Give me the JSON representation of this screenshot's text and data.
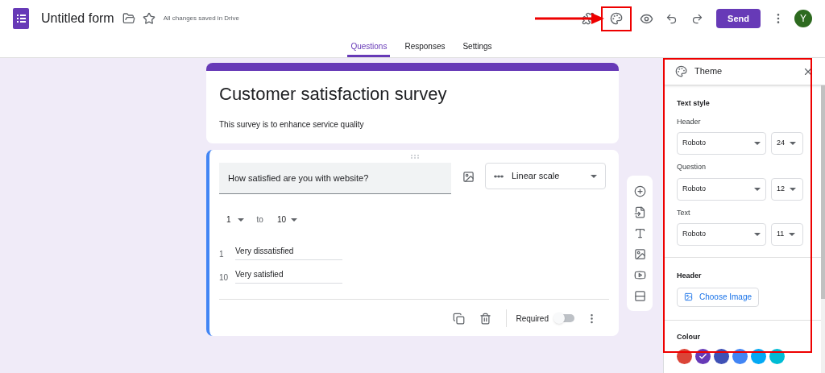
{
  "header": {
    "title": "Untitled form",
    "save_status": "All changes saved in Drive",
    "send_label": "Send",
    "avatar_letter": "Y"
  },
  "tabs": [
    {
      "label": "Questions",
      "selected": true
    },
    {
      "label": "Responses",
      "selected": false
    },
    {
      "label": "Settings",
      "selected": false
    }
  ],
  "form": {
    "title": "Customer satisfaction survey",
    "description": "This survey is to enhance service quality"
  },
  "question": {
    "text": "How satisfied are you with website?",
    "type": "Linear scale",
    "scale_from": "1",
    "scale_to_label": "to",
    "scale_to": "10",
    "labels": [
      {
        "number": "1",
        "value": "Very dissatisfied"
      },
      {
        "number": "10",
        "value": "Very satisfied"
      }
    ],
    "required_label": "Required",
    "required": false
  },
  "theme": {
    "title": "Theme",
    "text_style_heading": "Text style",
    "styles": [
      {
        "label": "Header",
        "font": "Roboto",
        "size": "24"
      },
      {
        "label": "Question",
        "font": "Roboto",
        "size": "12"
      },
      {
        "label": "Text",
        "font": "Roboto",
        "size": "11"
      }
    ],
    "header_heading": "Header",
    "choose_image": "Choose Image",
    "colour_heading": "Colour",
    "colours": [
      {
        "color": "#db4437",
        "selected": false
      },
      {
        "color": "#673ab7",
        "selected": true
      },
      {
        "color": "#3f51b5",
        "selected": false
      },
      {
        "color": "#4285f4",
        "selected": false
      },
      {
        "color": "#03a9f4",
        "selected": false
      },
      {
        "color": "#00bcd4",
        "selected": false
      }
    ]
  }
}
